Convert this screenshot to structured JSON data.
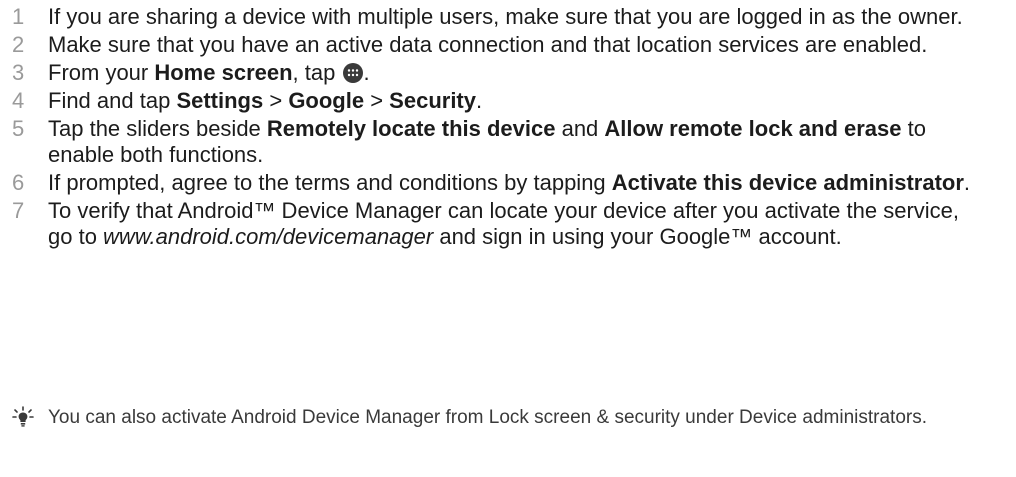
{
  "steps": [
    {
      "num": "1",
      "parts": [
        {
          "t": "If you are sharing a device with multiple users, make sure that you are logged in as the owner.",
          "s": "n"
        }
      ]
    },
    {
      "num": "2",
      "parts": [
        {
          "t": "Make sure that you have an active data connection and that location services are enabled.",
          "s": "n"
        }
      ]
    },
    {
      "num": "3",
      "parts": [
        {
          "t": "From your ",
          "s": "n"
        },
        {
          "t": "Home screen",
          "s": "b"
        },
        {
          "t": ", tap ",
          "s": "n"
        },
        {
          "t": ".",
          "s": "n"
        }
      ]
    },
    {
      "num": "4",
      "parts": [
        {
          "t": "Find and tap ",
          "s": "n"
        },
        {
          "t": "Settings",
          "s": "b"
        },
        {
          "t": " > ",
          "s": "n"
        },
        {
          "t": "Google",
          "s": "b"
        },
        {
          "t": " > ",
          "s": "n"
        },
        {
          "t": "Security",
          "s": "b"
        },
        {
          "t": ".",
          "s": "n"
        }
      ]
    },
    {
      "num": "5",
      "parts": [
        {
          "t": "Tap the sliders beside ",
          "s": "n"
        },
        {
          "t": "Remotely locate this device",
          "s": "b"
        },
        {
          "t": " and ",
          "s": "n"
        },
        {
          "t": "Allow remote lock and erase",
          "s": "b"
        },
        {
          "t": " to enable both functions.",
          "s": "n"
        }
      ]
    },
    {
      "num": "6",
      "parts": [
        {
          "t": "If prompted, agree to the terms and conditions by tapping ",
          "s": "n"
        },
        {
          "t": "Activate this device administrator",
          "s": "b"
        },
        {
          "t": ".",
          "s": "n"
        }
      ]
    },
    {
      "num": "7",
      "parts": [
        {
          "t": "To verify that Android™ Device Manager can locate your device after you activate the service, go to ",
          "s": "n"
        },
        {
          "t": "www.android.com/devicemanager",
          "s": "i"
        },
        {
          "t": " and sign in using your Google™ account.",
          "s": "n"
        }
      ]
    }
  ],
  "tip": {
    "icon": "lightbulb-icon",
    "text": "You can also activate Android Device Manager from Lock screen & security under Device administrators."
  },
  "colors": {
    "text": "#1c1c1c",
    "number": "#9a9a9a",
    "tip_text": "#3a3a3a",
    "apps_icon": "#3a3a3a"
  }
}
